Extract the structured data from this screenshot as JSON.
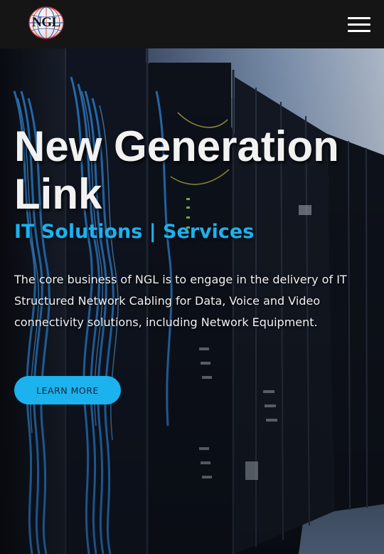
{
  "header": {
    "logo_text": "NGL",
    "menu_icon": "hamburger-menu-icon"
  },
  "hero": {
    "title": "New Generation Link",
    "subtitle": "IT Solutions | Services",
    "description": "The core business of NGL is to engage in the delivery of IT Structured Network Cabling for Data, Voice and Video connectivity solutions, including Network Equipment.",
    "cta_label": "LEARN MORE"
  },
  "colors": {
    "header_bg": "#151515",
    "accent": "#1cb2ee",
    "title_text": "#f2f2f2",
    "cable_blue": "#2f8fe8"
  }
}
